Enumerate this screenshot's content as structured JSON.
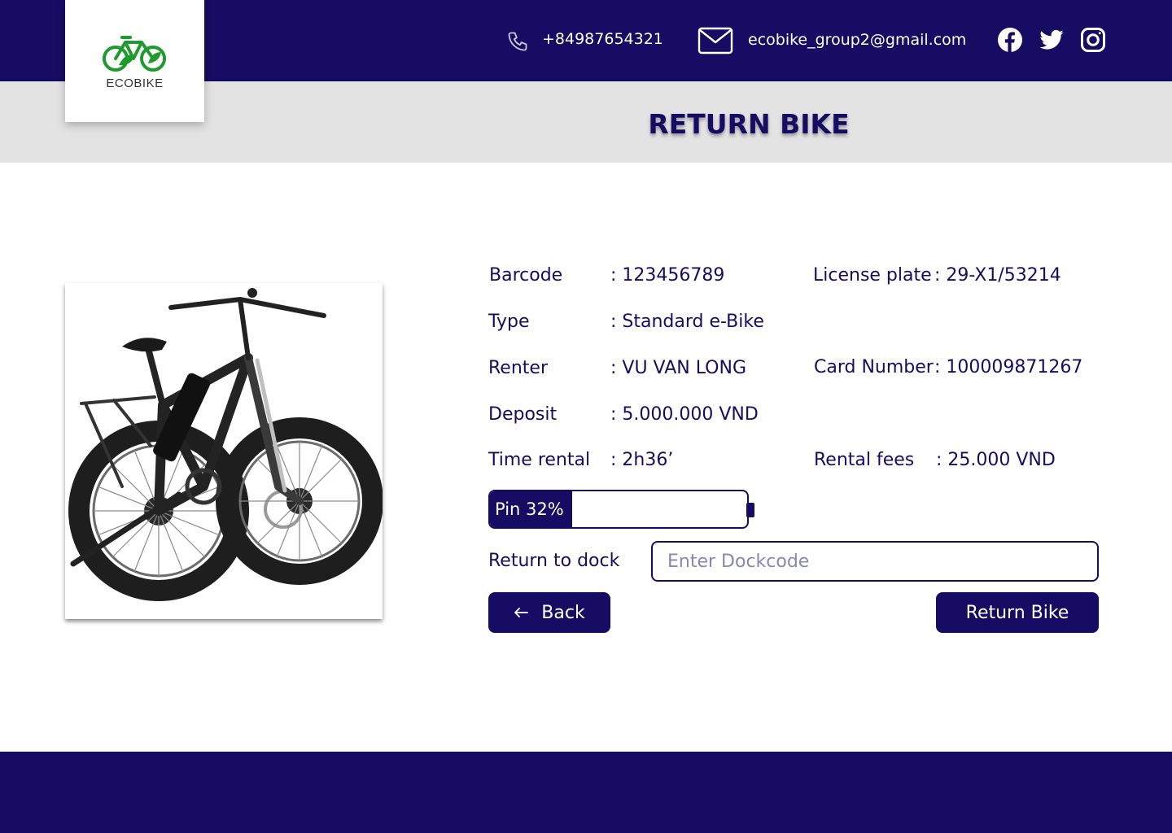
{
  "brand": {
    "name_part1": "ECO",
    "name_part2": "BIKE",
    "green": "#1f9a2e",
    "navy": "#160c63"
  },
  "header": {
    "phone": "+84987654321",
    "email": "ecobike_group2@gmail.com",
    "social": [
      "facebook-icon",
      "twitter-icon",
      "instagram-icon"
    ]
  },
  "page": {
    "title": "RETURN BIKE"
  },
  "bike": {
    "barcode_label": "Barcode",
    "barcode_value": ": 123456789",
    "license_label": "License plate",
    "license_value": ": 29-X1/53214",
    "type_label": "Type",
    "type_value": ": Standard e-Bike",
    "renter_label": "Renter",
    "renter_value": ": VU VAN LONG",
    "card_label": "Card Number",
    "card_value": ": 100009871267",
    "deposit_label": "Deposit",
    "deposit_value": ": 5.000.000 VND",
    "time_label": "Time rental",
    "time_value": ": 2h36’",
    "fees_label": "Rental fees",
    "fees_value": ": 25.000 VND",
    "battery_label": "Pin 32%",
    "battery_percent": 32
  },
  "form": {
    "dock_label": "Return to dock",
    "dock_placeholder": "Enter Dockcode",
    "dock_value": ""
  },
  "actions": {
    "back_label": "Back",
    "return_label": "Return Bike"
  }
}
